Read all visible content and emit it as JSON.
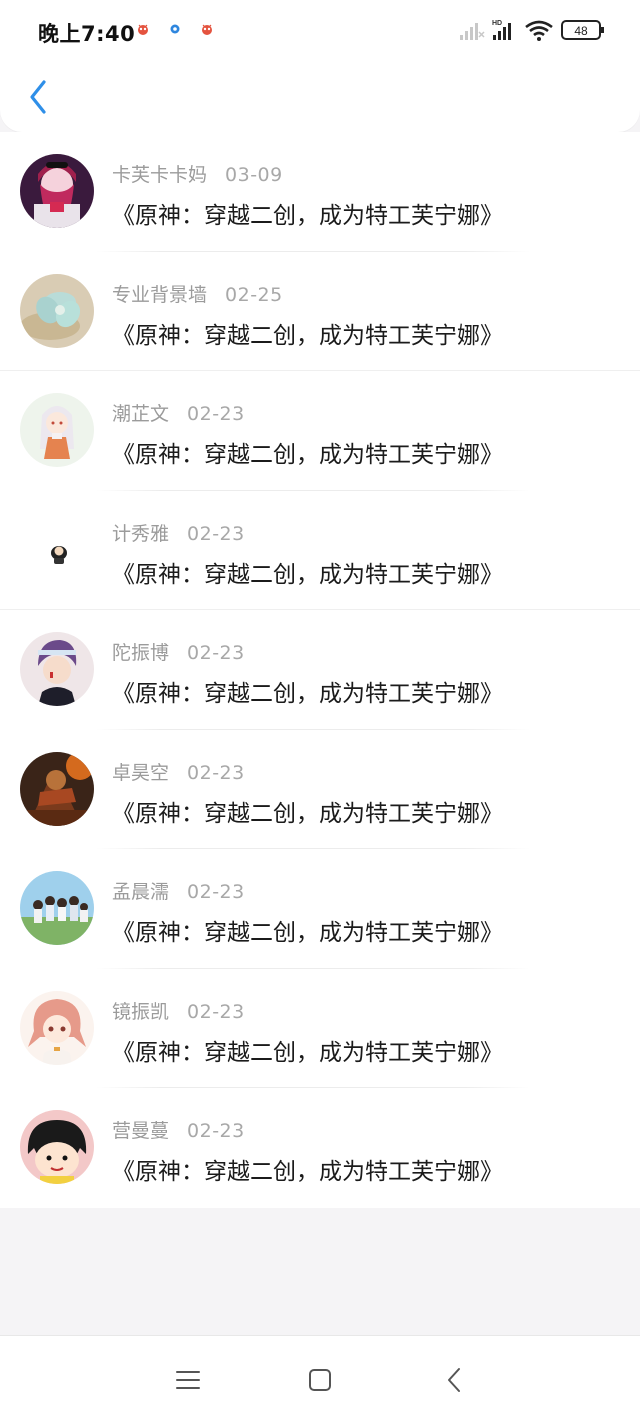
{
  "status_bar": {
    "time": "晚上7:40",
    "battery": "48",
    "network_label": "HD"
  },
  "header": {
    "back_icon": "chevron-left-icon"
  },
  "list": {
    "items": [
      {
        "name": "卡芙卡卡妈",
        "date": "03-09",
        "title": "《原神：穿越二创，成为特工芙宁娜》"
      },
      {
        "name": "专业背景墙",
        "date": "02-25",
        "title": "《原神：穿越二创，成为特工芙宁娜》"
      },
      {
        "name": "潮芷文",
        "date": "02-23",
        "title": "《原神：穿越二创，成为特工芙宁娜》"
      },
      {
        "name": "计秀雅",
        "date": "02-23",
        "title": "《原神：穿越二创，成为特工芙宁娜》"
      },
      {
        "name": "陀振博",
        "date": "02-23",
        "title": "《原神：穿越二创，成为特工芙宁娜》"
      },
      {
        "name": "卓昊空",
        "date": "02-23",
        "title": "《原神：穿越二创，成为特工芙宁娜》"
      },
      {
        "name": "孟晨濡",
        "date": "02-23",
        "title": "《原神：穿越二创，成为特工芙宁娜》"
      },
      {
        "name": "镜振凯",
        "date": "02-23",
        "title": "《原神：穿越二创，成为特工芙宁娜》"
      },
      {
        "name": "营曼蔓",
        "date": "02-23",
        "title": "《原神：穿越二创，成为特工芙宁娜》"
      }
    ]
  },
  "nav_bar": {
    "menu_icon": "menu-icon",
    "home_icon": "home-square-icon",
    "back_icon": "back-triangle-icon"
  },
  "colors": {
    "accent": "#2f8fe8",
    "page_bg": "#f5f4f6",
    "text_primary": "#1b1b1b",
    "text_secondary": "#9b9b9b"
  }
}
